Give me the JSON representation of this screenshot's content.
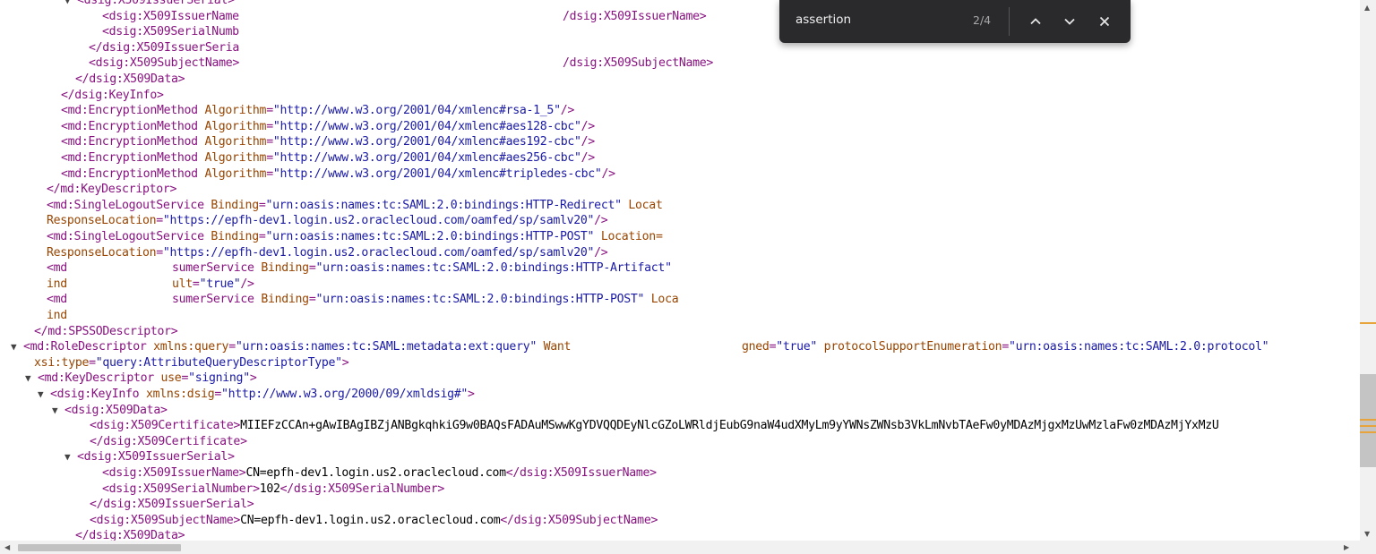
{
  "find_bar": {
    "query": "assertion",
    "match_count": "2/4",
    "icons": [
      "chevron-up-icon",
      "chevron-down-icon",
      "close-icon"
    ]
  },
  "xml_lines": [
    {
      "indent": 0,
      "toggle": "▼",
      "parts": [
        [
          "tag",
          "<dsig:X509IssuerSerial>"
        ]
      ]
    },
    {
      "indent": 0,
      "toggle": "",
      "parts": [
        [
          "tag",
          "<dsig:X509IssuerName"
        ]
      ],
      "trail": [
        [
          "tag",
          "/dsig:X509IssuerName>"
        ]
      ]
    },
    {
      "indent": 0,
      "toggle": "",
      "parts": [
        [
          "tag",
          "<dsig:X509SerialNumb"
        ]
      ]
    },
    {
      "indent": 0,
      "toggle": "",
      "parts": [
        [
          "tag",
          "</dsig:X509IssuerSeria"
        ]
      ]
    },
    {
      "indent": 0,
      "toggle": "",
      "parts": [
        [
          "tag",
          "<dsig:X509SubjectName>"
        ]
      ],
      "trail": [
        [
          "tag",
          "/dsig:X509SubjectName>"
        ]
      ]
    },
    {
      "indent": 0,
      "toggle": "",
      "parts": [
        [
          "tag",
          "</dsig:X509Data>"
        ]
      ]
    },
    {
      "indent": 0,
      "toggle": "",
      "parts": [
        [
          "tag",
          "</dsig:KeyInfo>"
        ]
      ]
    },
    {
      "indent": 0,
      "toggle": "",
      "parts": [
        [
          "tag",
          "<md:EncryptionMethod "
        ],
        [
          "atn",
          "Algorithm"
        ],
        [
          "tag",
          "="
        ],
        [
          "atv",
          "\"http://www.w3.org/2001/04/xmlenc#rsa-1_5\""
        ],
        [
          "tag",
          "/>"
        ]
      ]
    },
    {
      "indent": 0,
      "toggle": "",
      "parts": [
        [
          "tag",
          "<md:EncryptionMethod "
        ],
        [
          "atn",
          "Algorithm"
        ],
        [
          "tag",
          "="
        ],
        [
          "atv",
          "\"http://www.w3.org/2001/04/xmlenc#aes128-cbc\""
        ],
        [
          "tag",
          "/>"
        ]
      ]
    },
    {
      "indent": 0,
      "toggle": "",
      "parts": [
        [
          "tag",
          "<md:EncryptionMethod "
        ],
        [
          "atn",
          "Algorithm"
        ],
        [
          "tag",
          "="
        ],
        [
          "atv",
          "\"http://www.w3.org/2001/04/xmlenc#aes192-cbc\""
        ],
        [
          "tag",
          "/>"
        ]
      ]
    },
    {
      "indent": 0,
      "toggle": "",
      "parts": [
        [
          "tag",
          "<md:EncryptionMethod "
        ],
        [
          "atn",
          "Algorithm"
        ],
        [
          "tag",
          "="
        ],
        [
          "atv",
          "\"http://www.w3.org/2001/04/xmlenc#aes256-cbc\""
        ],
        [
          "tag",
          "/>"
        ]
      ]
    },
    {
      "indent": 0,
      "toggle": "",
      "parts": [
        [
          "tag",
          "<md:EncryptionMethod "
        ],
        [
          "atn",
          "Algorithm"
        ],
        [
          "tag",
          "="
        ],
        [
          "atv",
          "\"http://www.w3.org/2001/04/xmlenc#tripledes-cbc\""
        ],
        [
          "tag",
          "/>"
        ]
      ]
    },
    {
      "indent": 0,
      "toggle": "",
      "parts": [
        [
          "tag",
          "</md:KeyDescriptor>"
        ]
      ]
    },
    {
      "indent": 0,
      "toggle": "",
      "parts": [
        [
          "tag",
          "<md:SingleLogoutService "
        ],
        [
          "atn",
          "Binding"
        ],
        [
          "tag",
          "="
        ],
        [
          "atv",
          "\"urn:oasis:names:tc:SAML:2.0:bindings:HTTP-Redirect\""
        ],
        [
          "atn",
          " Locat"
        ]
      ]
    },
    {
      "indent": 0,
      "toggle": "",
      "parts": [
        [
          "atn",
          "ResponseLocation"
        ],
        [
          "tag",
          "="
        ],
        [
          "atv",
          "\"https://epfh-dev1.login.us2.oraclecloud.com/oamfed/sp/samlv20\""
        ],
        [
          "tag",
          "/>"
        ]
      ]
    },
    {
      "indent": 0,
      "toggle": "",
      "parts": [
        [
          "tag",
          "<md:SingleLogoutService "
        ],
        [
          "atn",
          "Binding"
        ],
        [
          "tag",
          "="
        ],
        [
          "atv",
          "\"urn:oasis:names:tc:SAML:2.0:bindings:HTTP-POST\""
        ],
        [
          "atn",
          " Location="
        ]
      ]
    },
    {
      "indent": 0,
      "toggle": "",
      "parts": [
        [
          "atn",
          "ResponseLocation"
        ],
        [
          "tag",
          "="
        ],
        [
          "atv",
          "\"https://epfh-dev1.login.us2.oraclecloud.com/oamfed/sp/samlv20\""
        ],
        [
          "tag",
          "/>"
        ]
      ]
    },
    {
      "indent": 0,
      "toggle": "",
      "parts": [
        [
          "tag",
          "<md"
        ]
      ],
      "trail": [
        [
          "tag",
          "sumerService "
        ],
        [
          "atn",
          "Binding"
        ],
        [
          "tag",
          "="
        ],
        [
          "atv",
          "\"urn:oasis:names:tc:SAML:2.0:bindings:HTTP-Artifact\""
        ]
      ]
    },
    {
      "indent": 0,
      "toggle": "",
      "parts": [
        [
          "atn",
          "ind"
        ]
      ],
      "trail": [
        [
          "atn",
          "ult"
        ],
        [
          "tag",
          "="
        ],
        [
          "atv",
          "\"true\""
        ],
        [
          "tag",
          "/>"
        ]
      ]
    },
    {
      "indent": 0,
      "toggle": "",
      "parts": [
        [
          "tag",
          "<md"
        ]
      ],
      "trail": [
        [
          "tag",
          "sumerService "
        ],
        [
          "atn",
          "Binding"
        ],
        [
          "tag",
          "="
        ],
        [
          "atv",
          "\"urn:oasis:names:tc:SAML:2.0:bindings:HTTP-POST\""
        ],
        [
          "atn",
          " Loca"
        ]
      ]
    },
    {
      "indent": 0,
      "toggle": "",
      "parts": [
        [
          "atn",
          "ind"
        ]
      ]
    },
    {
      "indent": 0,
      "toggle": "",
      "parts": [
        [
          "tag",
          "</md:SPSSODescriptor>"
        ]
      ]
    },
    {
      "indent": 0,
      "toggle": "▼",
      "parts": [
        [
          "tag",
          "<md:RoleDescriptor "
        ],
        [
          "atn",
          "xmlns:query"
        ],
        [
          "tag",
          "="
        ],
        [
          "atv",
          "\"urn:oasis:names:tc:SAML:metadata:ext:query\""
        ],
        [
          "atn",
          " Want"
        ]
      ],
      "trail": [
        [
          "atn",
          "gned"
        ],
        [
          "tag",
          "="
        ],
        [
          "atv",
          "\"true\""
        ],
        [
          "atn",
          " protocolSupportEnumeration"
        ],
        [
          "tag",
          "="
        ],
        [
          "atv",
          "\"urn:oasis:names:tc:SAML:2.0:protocol\""
        ]
      ]
    },
    {
      "indent": 0,
      "toggle": "",
      "parts": [
        [
          "atn",
          "xsi:type"
        ],
        [
          "tag",
          "="
        ],
        [
          "atv",
          "\"query:AttributeQueryDescriptorType\""
        ],
        [
          "tag",
          ">"
        ]
      ]
    },
    {
      "indent": 0,
      "toggle": "▼",
      "parts": [
        [
          "tag",
          "<md:KeyDescriptor "
        ],
        [
          "atn",
          "use"
        ],
        [
          "tag",
          "="
        ],
        [
          "atv",
          "\"signing\""
        ],
        [
          "tag",
          ">"
        ]
      ]
    },
    {
      "indent": 0,
      "toggle": "▼",
      "parts": [
        [
          "tag",
          "<dsig:KeyInfo "
        ],
        [
          "atn",
          "xmlns:dsig"
        ],
        [
          "tag",
          "="
        ],
        [
          "atv",
          "\"http://www.w3.org/2000/09/xmldsig#\""
        ],
        [
          "tag",
          ">"
        ]
      ]
    },
    {
      "indent": 0,
      "toggle": "▼",
      "parts": [
        [
          "tag",
          "<dsig:X509Data>"
        ]
      ]
    },
    {
      "indent": 0,
      "toggle": "",
      "parts": [
        [
          "tag",
          "<dsig:X509Certificate>"
        ],
        [
          "txt",
          "MIIEFzCCAn+gAwIBAgIBZjANBgkqhkiG9w0BAQsFADAuMSwwKgYDVQQDEyNlcGZoLWRldjEubG9naW4udXMyLm9yYWNsZWNsb3VkLmNvbTAeFw0yMDAzMjgxMzUwMzlaFw0zMDAzMjYxMzU"
        ]
      ]
    },
    {
      "indent": 0,
      "toggle": "",
      "parts": [
        [
          "tag",
          "</dsig:X509Certificate>"
        ]
      ]
    },
    {
      "indent": 0,
      "toggle": "▼",
      "parts": [
        [
          "tag",
          "<dsig:X509IssuerSerial>"
        ]
      ]
    },
    {
      "indent": 0,
      "toggle": "",
      "parts": [
        [
          "tag",
          "<dsig:X509IssuerName>"
        ],
        [
          "txt",
          "CN=epfh-dev1.login.us2.oraclecloud.com"
        ],
        [
          "tag",
          "</dsig:X509IssuerName>"
        ]
      ]
    },
    {
      "indent": 0,
      "toggle": "",
      "parts": [
        [
          "tag",
          "<dsig:X509SerialNumber>"
        ],
        [
          "txt",
          "102"
        ],
        [
          "tag",
          "</dsig:X509SerialNumber>"
        ]
      ]
    },
    {
      "indent": 0,
      "toggle": "",
      "parts": [
        [
          "tag",
          "</dsig:X509IssuerSerial>"
        ]
      ]
    },
    {
      "indent": 0,
      "toggle": "",
      "parts": [
        [
          "tag",
          "<dsig:X509SubjectName>"
        ],
        [
          "txt",
          "CN=epfh-dev1.login.us2.oraclecloud.com"
        ],
        [
          "tag",
          "</dsig:X509SubjectName>"
        ]
      ]
    },
    {
      "indent": 0,
      "toggle": "",
      "parts": [
        [
          "tag",
          "</dsig:X509Data>"
        ]
      ]
    }
  ]
}
